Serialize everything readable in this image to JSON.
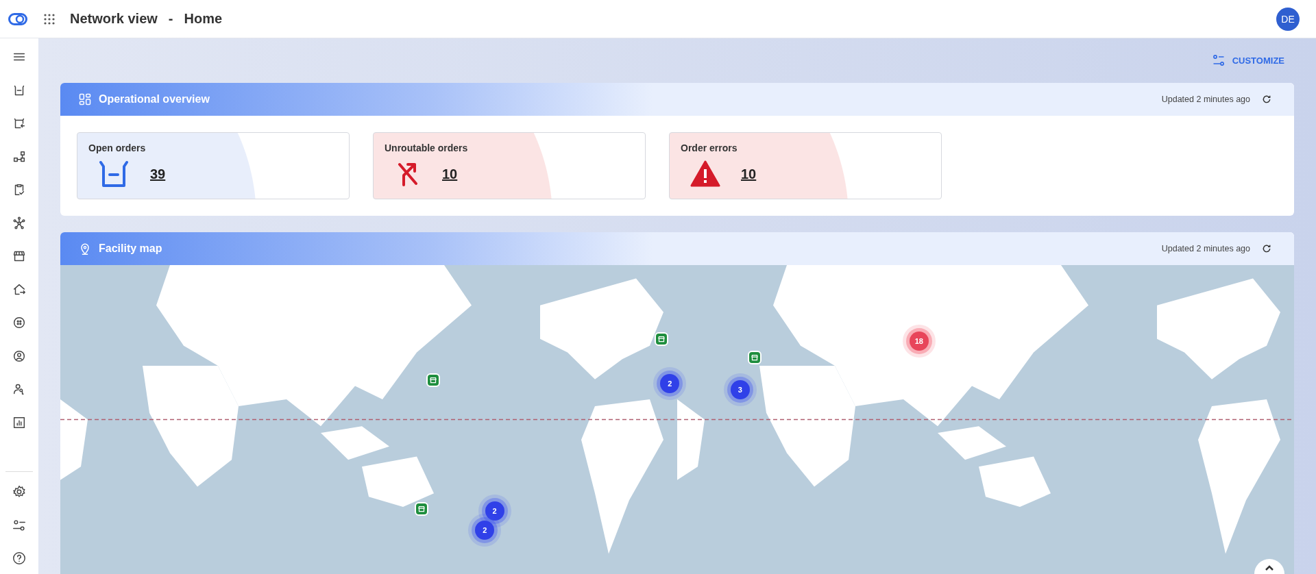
{
  "header": {
    "app_title": "Network view",
    "separator": "-",
    "page_title": "Home",
    "avatar": "DE"
  },
  "toolbar": {
    "customize": "CUSTOMIZE"
  },
  "overview": {
    "title": "Operational overview",
    "updated": "Updated 2 minutes ago",
    "cards": [
      {
        "label": "Open orders",
        "value": "39",
        "kind": "info"
      },
      {
        "label": "Unroutable orders",
        "value": "10",
        "kind": "route"
      },
      {
        "label": "Order errors",
        "value": "10",
        "kind": "error"
      }
    ]
  },
  "facility_map": {
    "title": "Facility map",
    "updated": "Updated 2 minutes ago",
    "markers": [
      {
        "kind": "facility"
      },
      {
        "kind": "facility"
      },
      {
        "kind": "facility"
      },
      {
        "kind": "facility"
      },
      {
        "kind": "cluster",
        "count": "2"
      },
      {
        "kind": "cluster",
        "count": "3"
      },
      {
        "kind": "cluster",
        "count": "2"
      },
      {
        "kind": "cluster",
        "count": "2"
      },
      {
        "kind": "alert",
        "count": "18"
      }
    ]
  }
}
